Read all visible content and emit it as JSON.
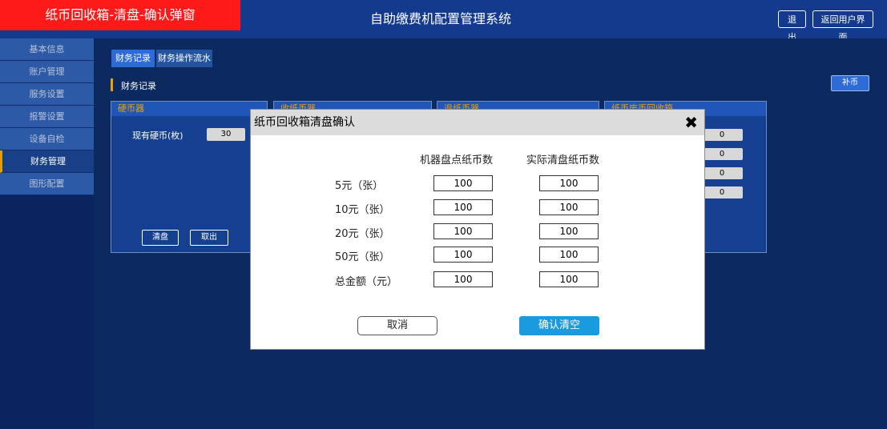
{
  "header": {
    "page_label": "纸币回收箱-清盘-确认弹窗",
    "system_title": "自助缴费机配置管理系统",
    "logout": "退出",
    "return_user": "返回用户界面"
  },
  "sidebar": {
    "items": [
      {
        "label": "基本信息"
      },
      {
        "label": "账户管理"
      },
      {
        "label": "服务设置"
      },
      {
        "label": "报警设置"
      },
      {
        "label": "设备自检"
      },
      {
        "label": "财务管理"
      },
      {
        "label": "图形配置"
      }
    ]
  },
  "main": {
    "tabs": [
      {
        "label": "财务记录"
      },
      {
        "label": "财务操作流水"
      }
    ],
    "section_title": "财务记录",
    "topup_button": "补币",
    "coin_panel": {
      "title": "硬币器",
      "stock_label": "现有硬币(枚)",
      "stock_value": "30",
      "clear_button": "清盘",
      "take_button": "取出"
    },
    "panel2_title": "收纸币器",
    "panel3_title": "退纸币器",
    "panel4_title": "纸币废币回收箱",
    "panel4_values": [
      "0",
      "0",
      "0",
      "0"
    ]
  },
  "modal": {
    "title": "纸币回收箱清盘确认",
    "close_icon": "close-icon",
    "col_machine": "机器盘点纸币数",
    "col_actual": "实际清盘纸币数",
    "rows": [
      {
        "label": "5元（张）",
        "machine": "100",
        "actual": "100"
      },
      {
        "label": "10元（张）",
        "machine": "100",
        "actual": "100"
      },
      {
        "label": "20元（张）",
        "machine": "100",
        "actual": "100"
      },
      {
        "label": "50元（张）",
        "machine": "100",
        "actual": "100"
      },
      {
        "label": "总金额（元）",
        "machine": "100",
        "actual": "100"
      }
    ],
    "cancel": "取消",
    "confirm": "确认清空"
  },
  "colors": {
    "accent_red": "#ff1a1a",
    "accent_orange": "#f0a000",
    "confirm_blue": "#1a9be0"
  }
}
